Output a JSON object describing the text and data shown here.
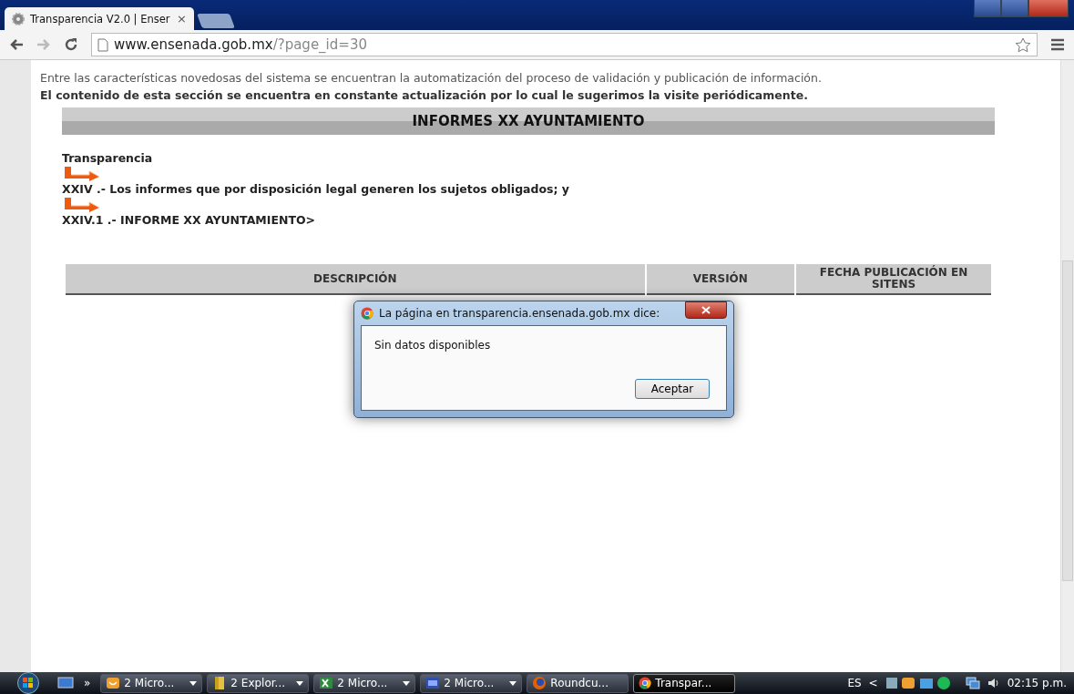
{
  "browser": {
    "tab": {
      "title": "Transparencia V2.0 | Enser",
      "close": "×"
    },
    "url_host": "www.ensenada.gob.mx",
    "url_path": "/?page_id=30"
  },
  "page": {
    "intro": "Entre las características novedosas del sistema se encuentran la automatización del proceso de validación y publicación de información.",
    "notice": "El contenido de esta sección se encuentra en constante actualización por lo cual le sugerimos la visite periódicamente.",
    "banner": "INFORMES XX AYUNTAMIENTO",
    "breadcrumb": [
      "Transparencia",
      "XXIV .- Los informes que por disposición legal generen los sujetos obligados; y",
      "XXIV.1 .- INFORME XX AYUNTAMIENTO>"
    ],
    "table": {
      "columns": [
        "DESCRIPCIÓN",
        "VERSIÓN",
        "FECHA PUBLICACIÓN EN SITENS"
      ]
    }
  },
  "dialog": {
    "title": "La página en transparencia.ensenada.gob.mx dice:",
    "message": "Sin datos disponibles",
    "button": "Aceptar"
  },
  "taskbar": {
    "items": [
      {
        "label": "2 Micro...",
        "kind": "mail",
        "group": true,
        "selected": false
      },
      {
        "label": "2 Explor...",
        "kind": "folder",
        "group": true,
        "selected": false
      },
      {
        "label": "2 Micro...",
        "kind": "excel",
        "group": true,
        "selected": false
      },
      {
        "label": "2 Micro...",
        "kind": "doc",
        "group": true,
        "selected": false
      },
      {
        "label": "Roundcu...",
        "kind": "firefox",
        "group": false,
        "selected": false
      },
      {
        "label": "Transpar...",
        "kind": "chrome",
        "group": false,
        "selected": true
      }
    ],
    "quicklaunch": "»",
    "language": "ES",
    "tray_expand": "<",
    "clock": "02:15 p.m."
  }
}
